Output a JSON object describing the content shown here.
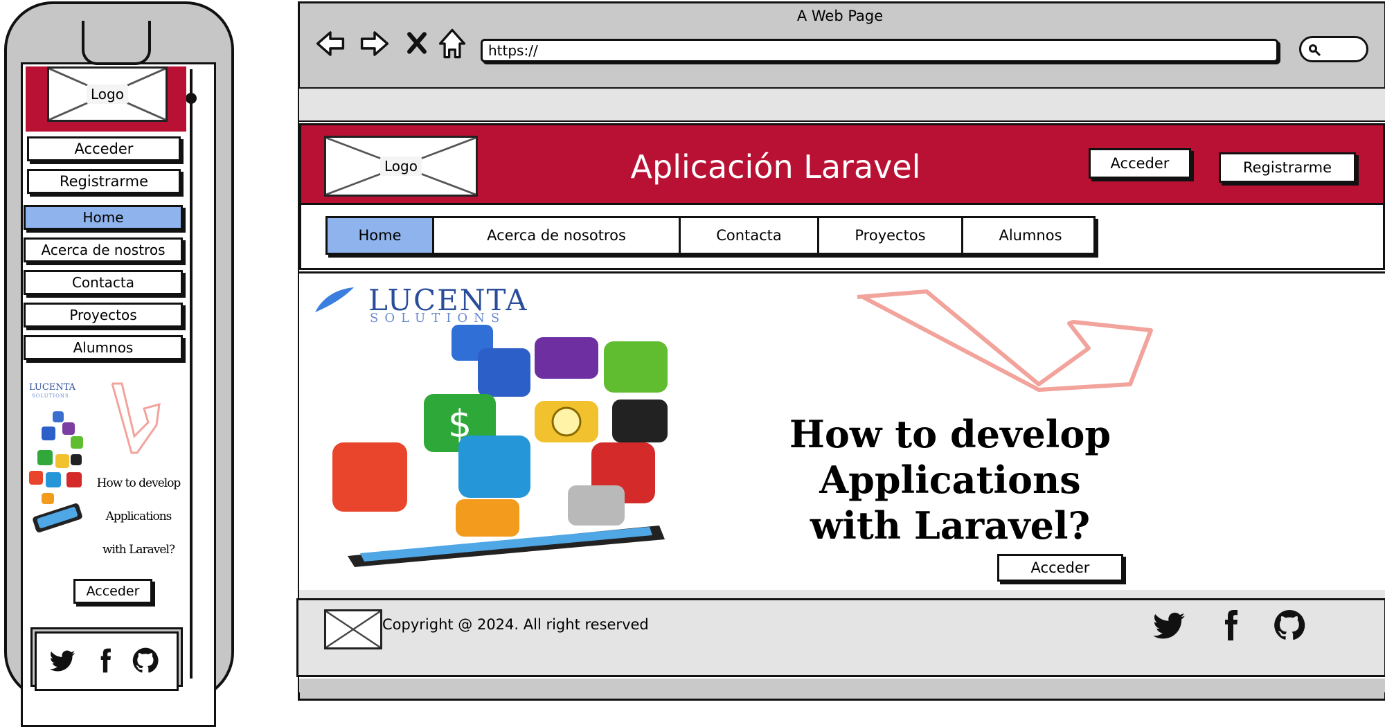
{
  "colors": {
    "brand_red": "#b91133",
    "active_blue": "#8fb3ec",
    "chrome_gray": "#c9c9c9",
    "bar_gray": "#e4e4e4"
  },
  "browser": {
    "title": "A Web Page",
    "url": "https://"
  },
  "header": {
    "logo": "Logo",
    "title": "Aplicación Laravel",
    "login": "Acceder",
    "register": "Registrarme"
  },
  "nav": [
    "Home",
    "Acerca de nosotros",
    "Contacta",
    "Proyectos",
    "Alumnos"
  ],
  "banner": {
    "brand": "LUCENTA",
    "brand_sub": "SOLUTIONS",
    "headline": [
      "How to develop",
      "Applications",
      "with Laravel?"
    ],
    "cta": "Acceder"
  },
  "footer": {
    "copyright": "Copyright @ 2024. All right reserved",
    "social": [
      "twitter-icon",
      "facebook-icon",
      "github-icon"
    ]
  },
  "mobile": {
    "logo": "Logo",
    "login": "Acceder",
    "register": "Registrarme",
    "menu": [
      "Home",
      "Acerca de nostros",
      "Contacta",
      "Proyectos",
      "Alumnos"
    ],
    "banner": {
      "brand": "LUCENTA",
      "brand_sub": "SOLUTIONS",
      "headline": [
        "How to develop",
        "Applications",
        "with Laravel?"
      ],
      "cta": "Acceder"
    }
  }
}
